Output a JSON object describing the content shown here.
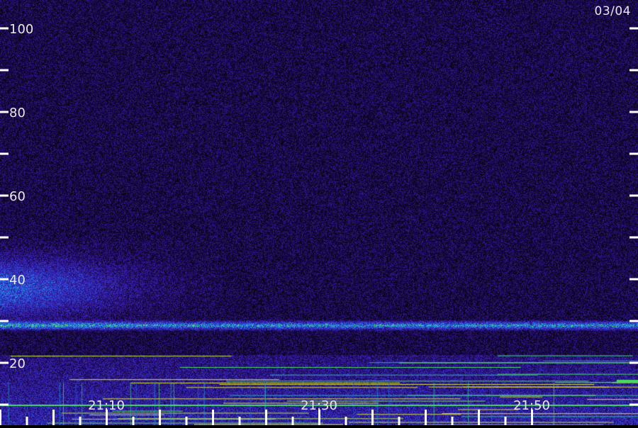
{
  "chart_data": {
    "type": "heatmap",
    "title": "",
    "date": "03/04",
    "xlabel": "",
    "ylabel": "",
    "x_tick_labels": [
      "21:10",
      "21:30",
      "21:50"
    ],
    "x_ticks_minutes": [
      20,
      40,
      60
    ],
    "x_range_minutes": [
      0,
      60
    ],
    "x_start_time": "21:00",
    "y_tick_labels": [
      "100",
      "80",
      "60",
      "40",
      "20"
    ],
    "y_ticks": [
      100,
      80,
      60,
      40,
      20
    ],
    "y_range": [
      0,
      105
    ],
    "colormap": [
      "#000000",
      "#1a0a4a",
      "#3a1ab0",
      "#2a4ad8",
      "#20a0e0",
      "#40e060",
      "#e0e040"
    ],
    "features": {
      "noise_floor_level": 0.18,
      "diffuse_band": {
        "y_range": [
          28,
          50
        ],
        "x_range_minutes": [
          0,
          28
        ],
        "intensity": 0.45
      },
      "horizontal_band": {
        "y": 29,
        "intensity": 0.6
      },
      "low_band": {
        "y_range": [
          0,
          22
        ],
        "intensity": 0.55
      }
    }
  },
  "colors": {
    "background": "#000000",
    "tick": "#ffffff",
    "label": "#e8e8e8"
  }
}
